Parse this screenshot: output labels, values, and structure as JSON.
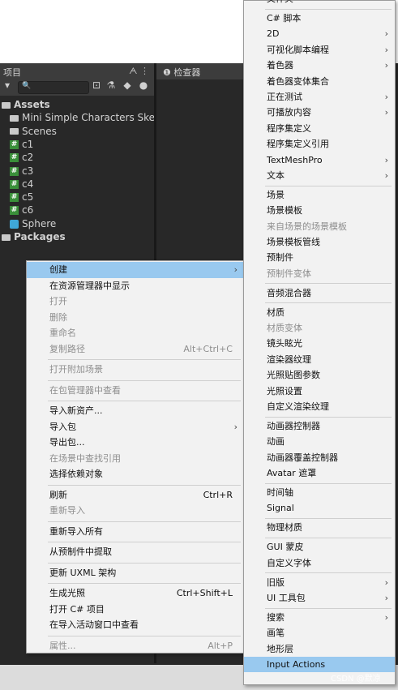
{
  "project_panel": {
    "title": "项目",
    "header_icons": "ᗅ ⋮",
    "tree": [
      {
        "label": "Assets",
        "type": "folder",
        "indent": 0
      },
      {
        "label": "Mini Simple Characters Ske",
        "type": "folder",
        "indent": 1
      },
      {
        "label": "Scenes",
        "type": "folder",
        "indent": 1
      },
      {
        "label": "c1",
        "type": "script",
        "indent": 1
      },
      {
        "label": "c2",
        "type": "script",
        "indent": 1
      },
      {
        "label": "c3",
        "type": "script",
        "indent": 1
      },
      {
        "label": "c4",
        "type": "script",
        "indent": 1
      },
      {
        "label": "c5",
        "type": "script",
        "indent": 1
      },
      {
        "label": "c6",
        "type": "script",
        "indent": 1
      },
      {
        "label": "Sphere",
        "type": "prefab",
        "indent": 1
      },
      {
        "label": "Packages",
        "type": "folder",
        "indent": 0
      }
    ]
  },
  "inspector_panel": {
    "title": "❶ 检查器"
  },
  "search": {
    "placeholder": "🔍"
  },
  "left_menu": {
    "items": [
      {
        "label": "创建",
        "shortcut": "",
        "submenu": true,
        "disabled": false,
        "highlighted": true
      },
      {
        "label": "在资源管理器中显示",
        "shortcut": "",
        "submenu": false,
        "disabled": false
      },
      {
        "label": "打开",
        "shortcut": "",
        "submenu": false,
        "disabled": true
      },
      {
        "label": "删除",
        "shortcut": "",
        "submenu": false,
        "disabled": true
      },
      {
        "label": "重命名",
        "shortcut": "",
        "submenu": false,
        "disabled": true
      },
      {
        "label": "复制路径",
        "shortcut": "Alt+Ctrl+C",
        "submenu": false,
        "disabled": true
      },
      {
        "sep": true
      },
      {
        "label": "打开附加场景",
        "shortcut": "",
        "submenu": false,
        "disabled": true
      },
      {
        "sep": true
      },
      {
        "label": "在包管理器中查看",
        "shortcut": "",
        "submenu": false,
        "disabled": true
      },
      {
        "sep": true
      },
      {
        "label": "导入新资产...",
        "shortcut": "",
        "submenu": false,
        "disabled": false
      },
      {
        "label": "导入包",
        "shortcut": "",
        "submenu": true,
        "disabled": false
      },
      {
        "label": "导出包...",
        "shortcut": "",
        "submenu": false,
        "disabled": false
      },
      {
        "label": "在场景中查找引用",
        "shortcut": "",
        "submenu": false,
        "disabled": true
      },
      {
        "label": "选择依赖对象",
        "shortcut": "",
        "submenu": false,
        "disabled": false
      },
      {
        "sep": true
      },
      {
        "label": "刷新",
        "shortcut": "Ctrl+R",
        "submenu": false,
        "disabled": false
      },
      {
        "label": "重新导入",
        "shortcut": "",
        "submenu": false,
        "disabled": true
      },
      {
        "sep": true
      },
      {
        "label": "重新导入所有",
        "shortcut": "",
        "submenu": false,
        "disabled": false
      },
      {
        "sep": true
      },
      {
        "label": "从预制件中提取",
        "shortcut": "",
        "submenu": false,
        "disabled": false
      },
      {
        "sep": true
      },
      {
        "label": "更新 UXML 架构",
        "shortcut": "",
        "submenu": false,
        "disabled": false
      },
      {
        "sep": true
      },
      {
        "label": "生成光照",
        "shortcut": "Ctrl+Shift+L",
        "submenu": false,
        "disabled": false
      },
      {
        "label": "打开 C# 项目",
        "shortcut": "",
        "submenu": false,
        "disabled": false
      },
      {
        "label": "在导入活动窗口中查看",
        "shortcut": "",
        "submenu": false,
        "disabled": false
      },
      {
        "sep": true
      },
      {
        "label": "属性...",
        "shortcut": "Alt+P",
        "submenu": false,
        "disabled": true
      }
    ]
  },
  "right_menu": {
    "items": [
      {
        "label": "文件夹",
        "submenu": false,
        "disabled": false,
        "partial": true
      },
      {
        "sep": true
      },
      {
        "label": "C# 脚本",
        "submenu": false,
        "disabled": false
      },
      {
        "label": "2D",
        "submenu": true,
        "disabled": false
      },
      {
        "label": "可视化脚本编程",
        "submenu": true,
        "disabled": false
      },
      {
        "label": "着色器",
        "submenu": true,
        "disabled": false
      },
      {
        "label": "着色器变体集合",
        "submenu": false,
        "disabled": false
      },
      {
        "label": "正在测试",
        "submenu": true,
        "disabled": false
      },
      {
        "label": "可播放内容",
        "submenu": true,
        "disabled": false
      },
      {
        "label": "程序集定义",
        "submenu": false,
        "disabled": false
      },
      {
        "label": "程序集定义引用",
        "submenu": false,
        "disabled": false
      },
      {
        "label": "TextMeshPro",
        "submenu": true,
        "disabled": false
      },
      {
        "label": "文本",
        "submenu": true,
        "disabled": false
      },
      {
        "sep": true
      },
      {
        "label": "场景",
        "submenu": false,
        "disabled": false
      },
      {
        "label": "场景模板",
        "submenu": false,
        "disabled": false
      },
      {
        "label": "来自场景的场景模板",
        "submenu": false,
        "disabled": true
      },
      {
        "label": "场景模板管线",
        "submenu": false,
        "disabled": false
      },
      {
        "label": "预制件",
        "submenu": false,
        "disabled": false
      },
      {
        "label": "预制件变体",
        "submenu": false,
        "disabled": true
      },
      {
        "sep": true
      },
      {
        "label": "音频混合器",
        "submenu": false,
        "disabled": false
      },
      {
        "sep": true
      },
      {
        "label": "材质",
        "submenu": false,
        "disabled": false
      },
      {
        "label": "材质变体",
        "submenu": false,
        "disabled": true
      },
      {
        "label": "镜头眩光",
        "submenu": false,
        "disabled": false
      },
      {
        "label": "渲染器纹理",
        "submenu": false,
        "disabled": false
      },
      {
        "label": "光照贴图参数",
        "submenu": false,
        "disabled": false
      },
      {
        "label": "光照设置",
        "submenu": false,
        "disabled": false
      },
      {
        "label": "自定义渲染纹理",
        "submenu": false,
        "disabled": false
      },
      {
        "sep": true
      },
      {
        "label": "动画器控制器",
        "submenu": false,
        "disabled": false
      },
      {
        "label": "动画",
        "submenu": false,
        "disabled": false
      },
      {
        "label": "动画器覆盖控制器",
        "submenu": false,
        "disabled": false
      },
      {
        "label": "Avatar 遮罩",
        "submenu": false,
        "disabled": false
      },
      {
        "sep": true
      },
      {
        "label": "时间轴",
        "submenu": false,
        "disabled": false
      },
      {
        "label": "Signal",
        "submenu": false,
        "disabled": false
      },
      {
        "sep": true
      },
      {
        "label": "物理材质",
        "submenu": false,
        "disabled": false
      },
      {
        "sep": true
      },
      {
        "label": "GUI 蒙皮",
        "submenu": false,
        "disabled": false
      },
      {
        "label": "自定义字体",
        "submenu": false,
        "disabled": false
      },
      {
        "sep": true
      },
      {
        "label": "旧版",
        "submenu": true,
        "disabled": false
      },
      {
        "label": "UI 工具包",
        "submenu": true,
        "disabled": false
      },
      {
        "sep": true
      },
      {
        "label": "搜索",
        "submenu": true,
        "disabled": false
      },
      {
        "label": "画笔",
        "submenu": false,
        "disabled": false
      },
      {
        "label": "地形层",
        "submenu": false,
        "disabled": false
      },
      {
        "label": "Input Actions",
        "submenu": false,
        "disabled": false,
        "highlighted": true
      }
    ]
  },
  "watermark": "CSDN @默凉"
}
